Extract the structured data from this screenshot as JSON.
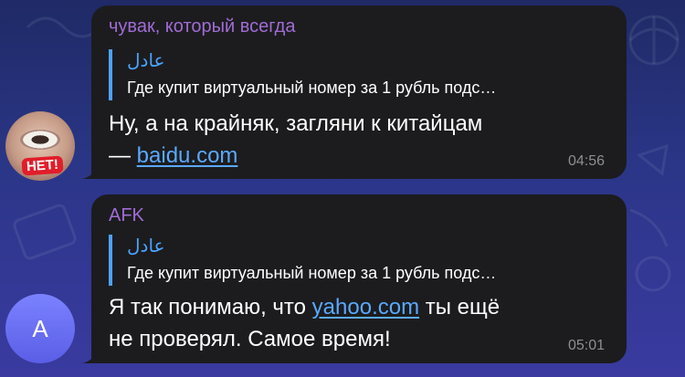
{
  "messages": [
    {
      "sender": "чувак, который всегда",
      "reply_name": "عادل",
      "reply_text": "Где купит виртуальный номер за 1 рубль подс…",
      "text_line1": "Ну, а на крайняк, загляни к китайцам",
      "text_prefix2": "— ",
      "link": "baidu.com",
      "time": "04:56",
      "avatar_stamp": "НЕТ!"
    },
    {
      "sender": "AFK",
      "reply_name": "عادل",
      "reply_text": "Где купит виртуальный номер за 1 рубль подс…",
      "text_prefix1": "Я так понимаю, что ",
      "link": "yahoo.com",
      "text_suffix1": " ты ещё",
      "text_line2": "не проверял. Самое время!",
      "time": "05:01",
      "avatar_letter": "A"
    }
  ],
  "colors": {
    "bubble": "#1c1c1e",
    "sender": "#a06cd5",
    "reply_accent": "#4aa3ff",
    "link": "#5aa9ff",
    "timestamp": "#8e8e93",
    "background_top": "#1f2a66",
    "background_bottom": "#3a3aa0"
  }
}
